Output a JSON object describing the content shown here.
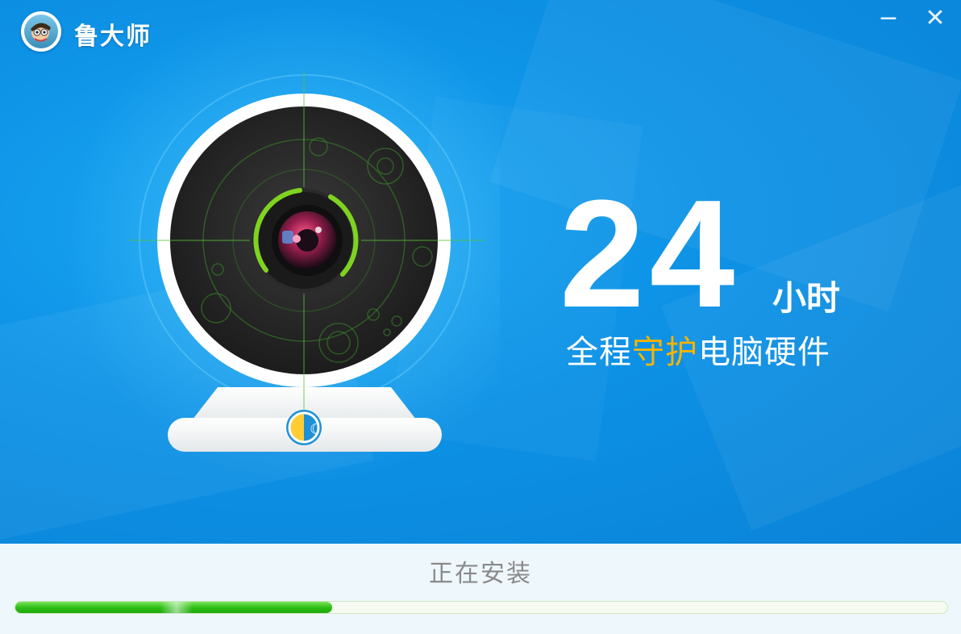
{
  "window": {
    "app_name": "鲁大师",
    "minimize_symbol": "−",
    "close_symbol": "✕",
    "logo_icon": "ludashi-mascot-icon"
  },
  "banner": {
    "big_number": "24",
    "unit": "小时",
    "slogan_before": "全程",
    "slogan_highlight": "守护",
    "slogan_after": "电脑硬件",
    "camera_icon": "webcam-radar-icon",
    "day_night_icon": "day-night-icon"
  },
  "footer": {
    "status_text": "正在安装",
    "progress": 0.34
  },
  "colors": {
    "banner_blue": "#0d92e6",
    "highlight_orange": "#f7b400",
    "progress_green": "#2bbd14",
    "footer_bg": "#eef7fc"
  }
}
